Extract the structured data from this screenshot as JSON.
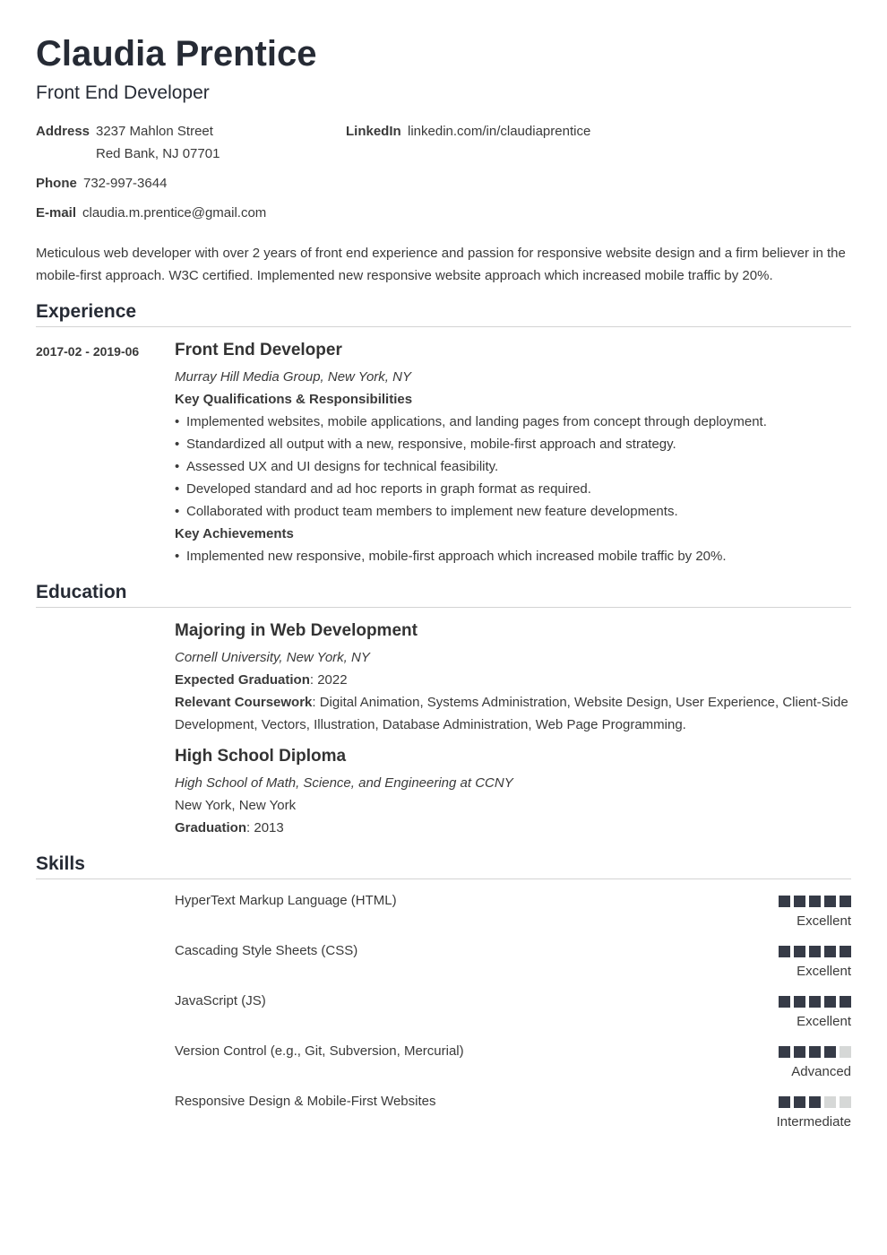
{
  "header": {
    "name": "Claudia Prentice",
    "role": "Front End Developer"
  },
  "contact": {
    "address_label": "Address",
    "address_line1": "3237 Mahlon Street",
    "address_line2": "Red Bank, NJ 07701",
    "linkedin_label": "LinkedIn",
    "linkedin": "linkedin.com/in/claudiaprentice",
    "phone_label": "Phone",
    "phone": "732-997-3644",
    "email_label": "E-mail",
    "email": "claudia.m.prentice@gmail.com"
  },
  "summary": "Meticulous web developer with over 2 years of front end experience and passion for responsive website design and a firm believer in the mobile-first approach. W3C certified. Implemented new responsive website approach which increased mobile traffic by 20%.",
  "experience": {
    "title": "Experience",
    "jobs": [
      {
        "dates": "2017-02 - 2019-06",
        "title": "Front End Developer",
        "company": "Murray Hill Media Group, New York, NY",
        "qual_heading": "Key Qualifications & Responsibilities",
        "bullets": [
          "Implemented websites, mobile applications, and landing pages from concept through deployment.",
          "Standardized all output with a new, responsive, mobile-first approach and strategy.",
          "Assessed UX and UI designs for technical feasibility.",
          "Developed standard and ad hoc reports in graph format as required.",
          "Collaborated with product team members to implement new feature developments."
        ],
        "achievements_heading": "Key Achievements",
        "achievements": [
          "Implemented new responsive, mobile-first approach which increased mobile traffic by 20%."
        ]
      }
    ]
  },
  "education": {
    "title": "Education",
    "entries": [
      {
        "degree": "Majoring in Web Development",
        "school": "Cornell University, New York, NY",
        "grad_label": "Expected Graduation",
        "grad_value": ": 2022",
        "coursework_label": "Relevant Coursework",
        "coursework_value": ": Digital Animation, Systems Administration, Website Design, User Experience, Client-Side Development, Vectors, Illustration, Database Administration, Web Page Programming."
      },
      {
        "degree": "High School Diploma",
        "school": "High School of Math, Science, and Engineering at CCNY",
        "location": "New York, New York",
        "grad_label": "Graduation",
        "grad_value": ": 2013"
      }
    ]
  },
  "skills": {
    "title": "Skills",
    "max_rating": 5,
    "items": [
      {
        "name": "HyperText Markup Language (HTML)",
        "rating": 5,
        "level": "Excellent"
      },
      {
        "name": "Cascading Style Sheets (CSS)",
        "rating": 5,
        "level": "Excellent"
      },
      {
        "name": "JavaScript (JS)",
        "rating": 5,
        "level": "Excellent"
      },
      {
        "name": "Version Control (e.g., Git, Subversion, Mercurial)",
        "rating": 4,
        "level": "Advanced"
      },
      {
        "name": "Responsive Design & Mobile-First Websites",
        "rating": 3,
        "level": "Intermediate"
      }
    ]
  },
  "colors": {
    "heading": "#262b35",
    "text": "#3a3a3a",
    "rating_on": "#363b47",
    "rating_off": "#d6d8d7",
    "divider": "#d3d3d3"
  }
}
